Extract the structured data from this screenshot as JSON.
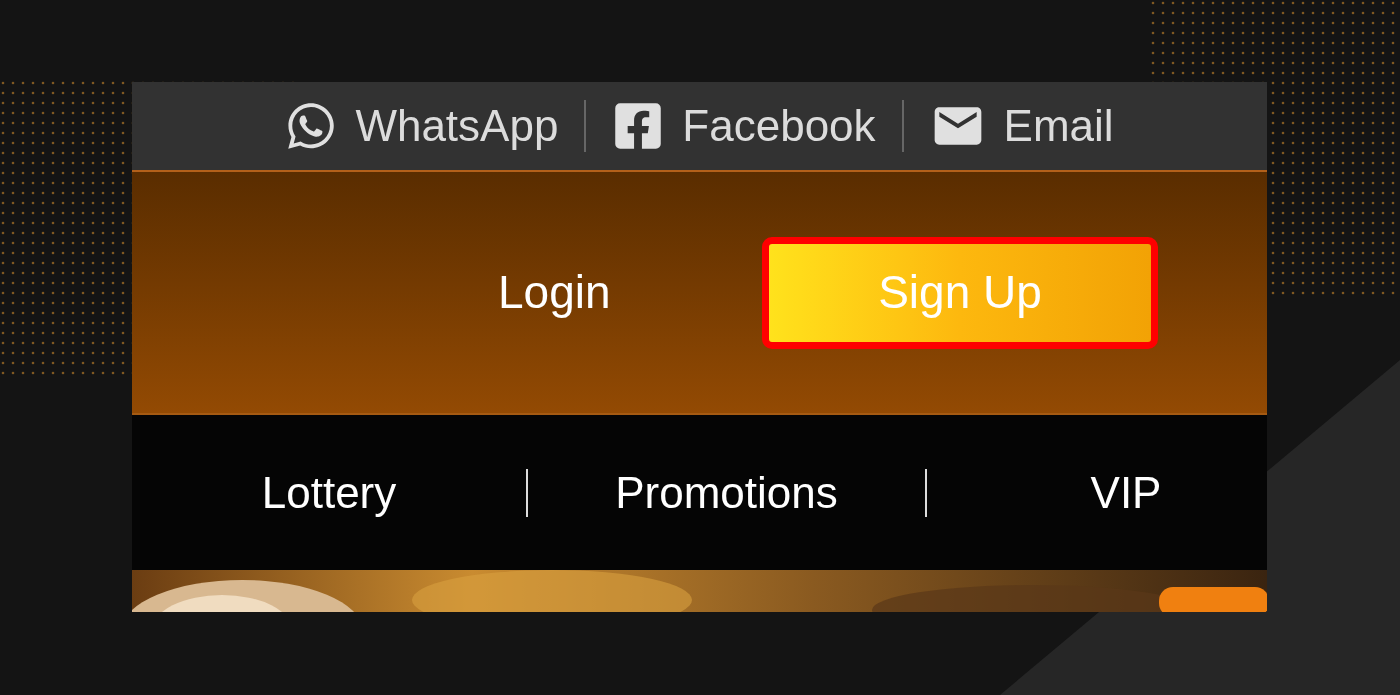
{
  "contacts": [
    {
      "kind": "whatsapp",
      "label": "WhatsApp"
    },
    {
      "kind": "facebook",
      "label": "Facebook"
    },
    {
      "kind": "email",
      "label": "Email"
    }
  ],
  "auth": {
    "login": "Login",
    "signup": {
      "label": "Sign Up",
      "highlighted": true
    }
  },
  "nav": [
    {
      "label": "Lottery"
    },
    {
      "label": "Promotions"
    },
    {
      "label": "VIP"
    }
  ]
}
